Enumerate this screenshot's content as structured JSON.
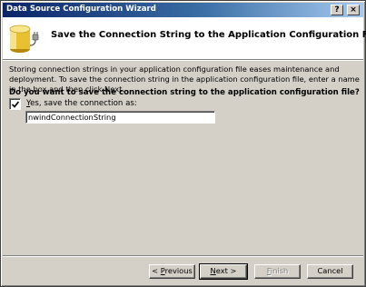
{
  "window": {
    "title": "Data Source Configuration Wizard",
    "help_glyph": "?",
    "close_glyph": "×"
  },
  "header": {
    "title": "Save the Connection String to the Application Configuration File",
    "icon": "database-plug-icon"
  },
  "body": {
    "description": "Storing connection strings in your application configuration file eases maintenance and deployment. To save the connection string in the application configuration file, enter a name in the box and then click Next.",
    "question": "Do you want to save the connection string to the application configuration file?",
    "save_checkbox": {
      "checked": true,
      "label_accel": "Y",
      "label_rest": "es, save the connection as:"
    },
    "connection_name": "nwindConnectionString"
  },
  "buttons": {
    "previous": {
      "prefix": "< ",
      "accel": "P",
      "rest": "revious"
    },
    "next": {
      "accel": "N",
      "rest": "ext >"
    },
    "finish": {
      "accel": "F",
      "rest": "inish",
      "enabled": false
    },
    "cancel": {
      "label": "Cancel"
    }
  },
  "colors": {
    "titlebar_start": "#0a246a",
    "titlebar_end": "#a6caf0",
    "dialog_face": "#d4d0c8"
  }
}
